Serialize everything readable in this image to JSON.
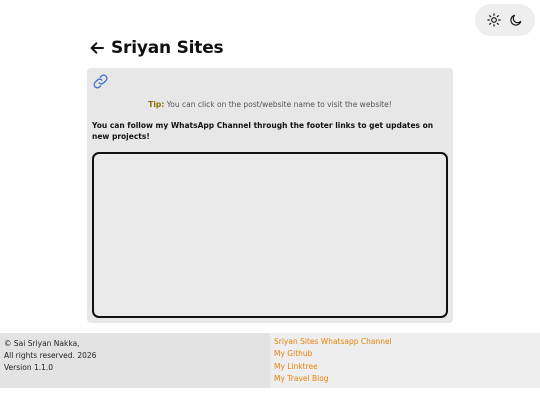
{
  "theme_toggle": {
    "light_icon": "sun-icon",
    "dark_icon": "moon-icon"
  },
  "header": {
    "back_icon": "arrow-left-icon",
    "title": "Sriyan Sites"
  },
  "card": {
    "link_icon": "link-icon",
    "tip_label": "Tip:",
    "tip_text": " You can click on the post/website name to visit the website!",
    "follow_text": "You can follow my WhatsApp Channel through the footer links to get updates on new projects!"
  },
  "footer": {
    "copyright": "© Sai Sriyan Nakka,",
    "rights": "All rights reserved. 2026",
    "version": "Version 1.1.0",
    "links": [
      "Sriyan Sites Whatsapp Channel",
      "My Github",
      "My Linktree",
      "My Travel Blog"
    ]
  },
  "colors": {
    "link": "#e8830a",
    "tip_label": "#8a6d00",
    "card_bg": "#e7e7e7"
  }
}
